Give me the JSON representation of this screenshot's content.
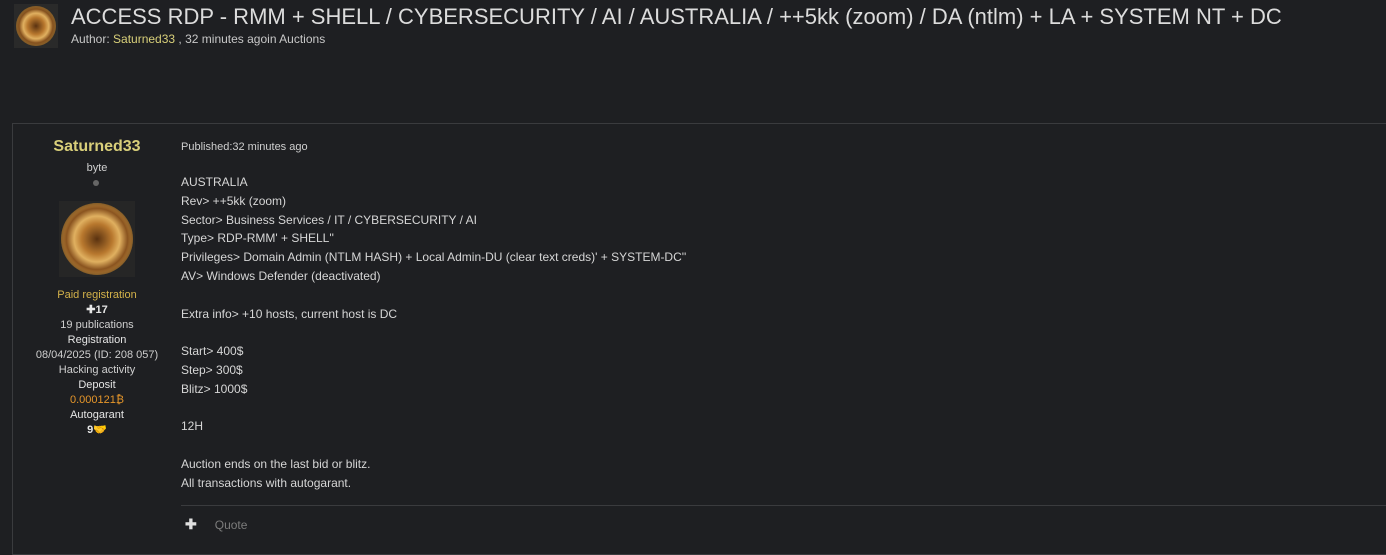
{
  "thread": {
    "title": "ACCESS RDP - RMM + SHELL / CYBERSECURITY / AI / AUSTRALIA / ++5kk (zoom) / DA (ntlm) + LA + SYSTEM NT + DC",
    "author_prefix": "Author: ",
    "author": "Saturned33",
    "time": " , 32 minutes ago",
    "in_prefix": "in ",
    "section": "Auctions"
  },
  "user": {
    "name": "Saturned33",
    "rank": "byte",
    "group": "Paid registration",
    "reputation_icon": "plus-circle-icon",
    "reputation": "17",
    "publications": "19 publications",
    "registration_label": "Registration",
    "registration_value": "08/04/2025 (ID: 208 057)",
    "activity": "Hacking activity",
    "deposit_label": "Deposit",
    "deposit_value": "0.000121",
    "deposit_symbol": "₿",
    "autogarant_label": "Autogarant",
    "autogarant_count": "9",
    "autogarant_icon": "handshake-icon"
  },
  "post": {
    "published_label": "Published:",
    "published_value": "32 minutes ago",
    "lines": [
      "AUSTRALIA",
      "Rev> ++5kk (zoom)",
      "Sector> Business Services / IT / CYBERSECURITY / AI",
      "Type> RDP-RMM' + SHELL''",
      "Privileges> Domain Admin (NTLM HASH) + Local Admin-DU (clear text creds)' + SYSTEM-DC''",
      "AV> Windows Defender (deactivated)",
      "",
      "Extra info> +10 hosts, current host is DC",
      "",
      "Start> 400$",
      "Step> 300$",
      "Blitz> 1000$",
      "",
      "12H",
      "",
      "Auction ends on the last bid or blitz.",
      "All transactions with autogarant."
    ],
    "actions": {
      "plus": "✚",
      "quote": "Quote"
    }
  },
  "colors": {
    "background": "#1e1f22",
    "username": "#d9cf7a",
    "deposit": "#e6962a",
    "border": "#3a3b3e"
  }
}
